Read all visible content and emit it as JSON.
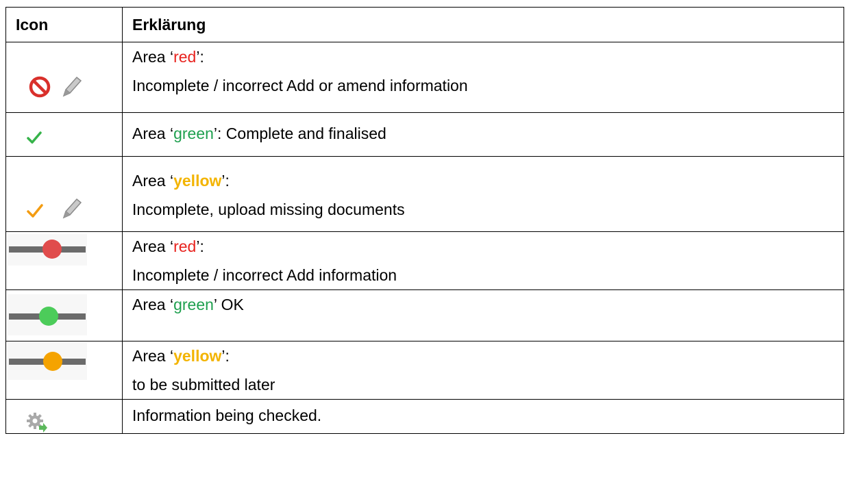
{
  "header": {
    "icon": "Icon",
    "explanation": "Erklärung"
  },
  "rows": [
    {
      "icons": [
        "prohibited-icon",
        "pencil-icon"
      ],
      "color": "#e8231f",
      "prefix": "Area ‘",
      "keyword": "red",
      "suffix": "’:",
      "line2": "Incomplete / incorrect  Add or amend information"
    },
    {
      "icons": [
        "green-check-icon"
      ],
      "color": "#36b34a",
      "prefix": "Area ‘",
      "keyword": "green",
      "suffix": "’: Complete and finalised"
    },
    {
      "icons": [
        "orange-check-icon",
        "pencil-icon"
      ],
      "color": "#f39c12",
      "prefix": "Area ‘",
      "keyword": "yellow",
      "suffix": "’:",
      "line2": "Incomplete, upload missing documents"
    },
    {
      "icons": [
        "red-status-slider-icon"
      ],
      "color": "#e04c4c",
      "prefix": "Area ‘",
      "keyword": "red",
      "suffix": "’:",
      "line2": "Incomplete / incorrect  Add information"
    },
    {
      "icons": [
        "green-status-slider-icon"
      ],
      "color": "#4ccc5a",
      "prefix": "Area ‘",
      "keyword": "green",
      "suffix": "’ OK"
    },
    {
      "icons": [
        "yellow-status-slider-icon"
      ],
      "color": "#f5a300",
      "prefix": "Area ‘",
      "keyword": "yellow",
      "suffix": "’:",
      "line2": "to be submitted later"
    },
    {
      "icons": [
        "gear-arrow-icon"
      ],
      "color": "#5cb85c",
      "text": "Information being checked."
    }
  ]
}
